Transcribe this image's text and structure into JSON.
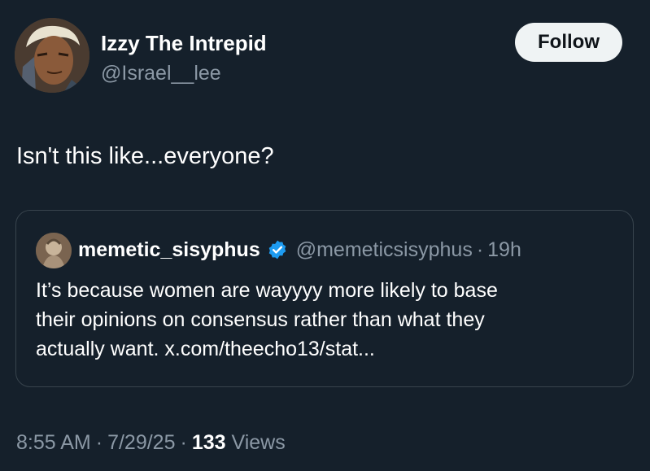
{
  "author": {
    "display_name": "Izzy The Intrepid",
    "handle": "@Israel__lee",
    "avatar_icon": "cartoon-character-avatar"
  },
  "follow_label": "Follow",
  "tweet": {
    "text": "Isn't this like...everyone?"
  },
  "quote": {
    "author_name": "memetic_sisyphus",
    "verified": true,
    "verified_color": "#1d9bf0",
    "handle": "@memeticsisyphus",
    "separator": "·",
    "time": "19h",
    "lines": [
      "It’s because women are wayyyy more likely to base",
      "their opinions on consensus rather than what they",
      "actually want. x.com/theecho13/stat..."
    ]
  },
  "meta": {
    "time": "8:55 AM",
    "date": "7/29/25",
    "separator": "·",
    "views_count": "133",
    "views_label": "Views"
  },
  "colors": {
    "background": "#15202b",
    "secondary_text": "#8b98a5",
    "border": "#38444d",
    "follow_bg": "#eff3f4"
  }
}
